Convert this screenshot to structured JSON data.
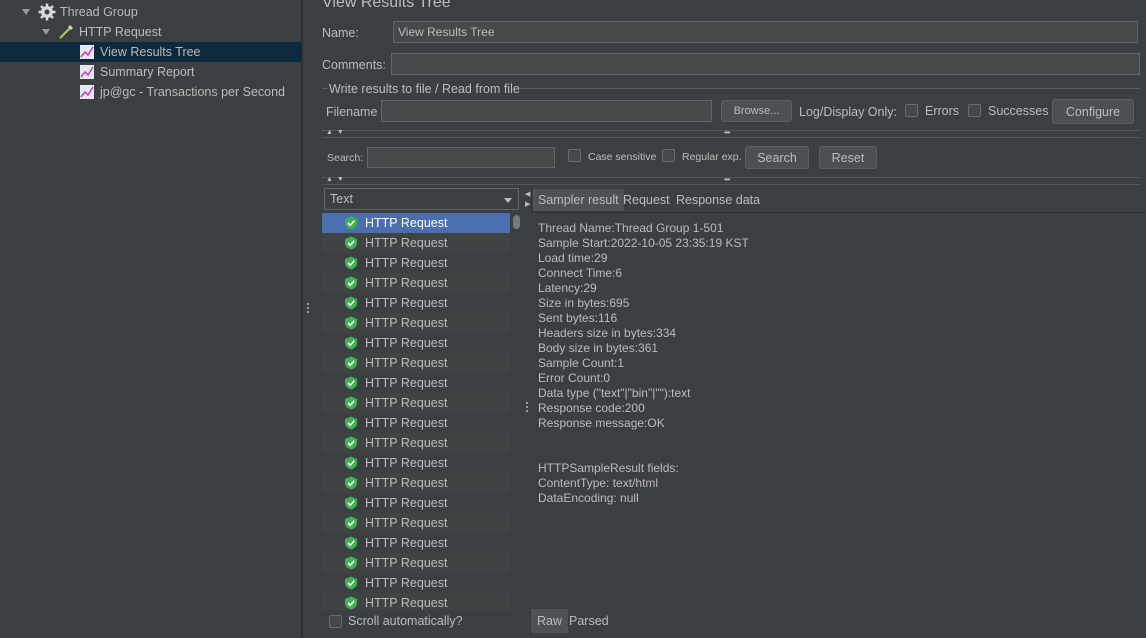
{
  "tree": {
    "items": [
      {
        "label": "Thread Group",
        "icon": "gear-icon"
      },
      {
        "label": "HTTP Request",
        "icon": "dropper-icon"
      },
      {
        "label": "View Results Tree",
        "icon": "graph-icon"
      },
      {
        "label": "Summary Report",
        "icon": "graph-icon"
      },
      {
        "label": "jp@gc - Transactions per Second",
        "icon": "graph-icon"
      }
    ]
  },
  "panel": {
    "title": "View Results Tree",
    "name_label": "Name:",
    "name_value": "View Results Tree",
    "comments_label": "Comments:",
    "comments_value": ""
  },
  "file_group": {
    "title": "Write results to file / Read from file",
    "filename_label": "Filename",
    "filename_value": "",
    "browse_label": "Browse...",
    "log_display_label": "Log/Display Only:",
    "errors_label": "Errors",
    "successes_label": "Successes",
    "configure_label": "Configure"
  },
  "search": {
    "label": "Search:",
    "value": "",
    "case_sensitive_label": "Case sensitive",
    "regex_label": "Regular exp.",
    "search_button": "Search",
    "reset_button": "Reset"
  },
  "results": {
    "renderer": "Text",
    "items": [
      "HTTP Request",
      "HTTP Request",
      "HTTP Request",
      "HTTP Request",
      "HTTP Request",
      "HTTP Request",
      "HTTP Request",
      "HTTP Request",
      "HTTP Request",
      "HTTP Request",
      "HTTP Request",
      "HTTP Request",
      "HTTP Request",
      "HTTP Request",
      "HTTP Request",
      "HTTP Request",
      "HTTP Request",
      "HTTP Request",
      "HTTP Request",
      "HTTP Request"
    ],
    "scroll_auto_label": "Scroll automatically?"
  },
  "tabs": [
    "Sampler result",
    "Request",
    "Response data"
  ],
  "detail": {
    "lines": [
      "Thread Name:Thread Group 1-501",
      "Sample Start:2022-10-05 23:35:19 KST",
      "Load time:29",
      "Connect Time:6",
      "Latency:29",
      "Size in bytes:695",
      "Sent bytes:116",
      "Headers size in bytes:334",
      "Body size in bytes:361",
      "Sample Count:1",
      "Error Count:0",
      "Data type (\"text\"|\"bin\"|\"\"):text",
      "Response code:200",
      "Response message:OK",
      "",
      "",
      "HTTPSampleResult fields:",
      "ContentType: text/html",
      "DataEncoding: null"
    ]
  },
  "bottom_tabs": [
    "Raw",
    "Parsed"
  ],
  "colors": {
    "background": "#3c3f41",
    "selection": "#4b6eaf",
    "tree_selection": "#0d293e",
    "success": "#3fb34f"
  }
}
